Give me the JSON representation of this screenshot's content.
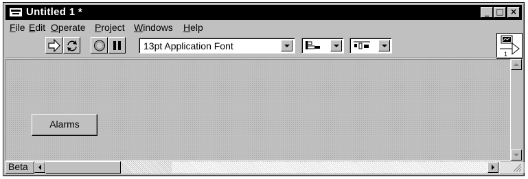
{
  "window": {
    "title": "Untitled 1 *",
    "controls": {
      "minimize": "_",
      "maximize": "□",
      "close": "×"
    }
  },
  "menubar": {
    "items": [
      {
        "label": "File",
        "mnemonic": "F",
        "rest": "ile"
      },
      {
        "label": "Edit",
        "mnemonic": "E",
        "rest": "dit"
      },
      {
        "label": "Operate",
        "mnemonic": "O",
        "rest": "perate"
      },
      {
        "label": "Project",
        "mnemonic": "P",
        "rest": "roject"
      },
      {
        "label": "Windows",
        "mnemonic": "W",
        "rest": "indows"
      },
      {
        "label": "Help",
        "mnemonic": "H",
        "rest": "elp"
      }
    ]
  },
  "toolbar": {
    "font_selector_value": "13pt Application Font",
    "icons": [
      "run-arrow-icon",
      "run-continuously-icon",
      "abort-execution-icon",
      "pause-icon",
      "align-objects-icon",
      "distribute-objects-icon"
    ]
  },
  "connector_pane": {
    "number": "1"
  },
  "panel": {
    "alarms_button_label": "Alarms"
  },
  "bottombar": {
    "context_label": "Beta"
  }
}
